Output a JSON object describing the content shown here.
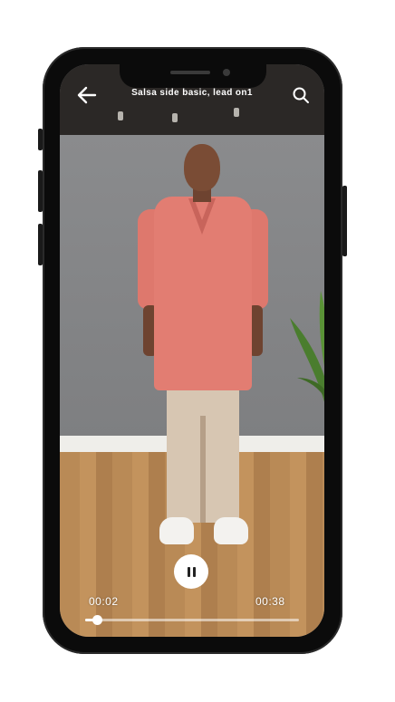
{
  "header": {
    "title": "Salsa side basic, lead on1",
    "back_icon": "arrow-left-icon",
    "search_icon": "search-icon"
  },
  "player": {
    "state_icon": "pause-icon",
    "current_time": "00:02",
    "total_time": "00:38",
    "progress_fraction": 0.053
  },
  "colors": {
    "controls": "#ffffff",
    "shirt": "#e27d72"
  }
}
